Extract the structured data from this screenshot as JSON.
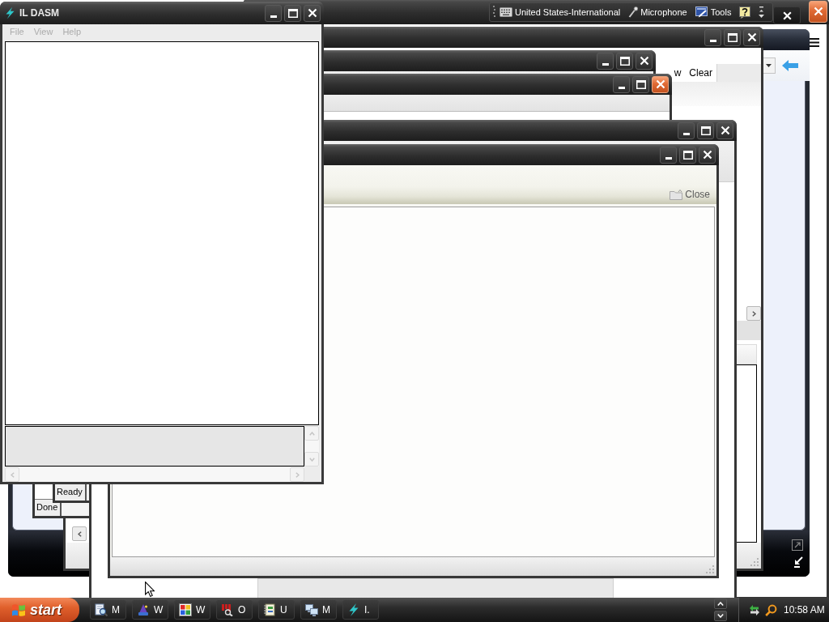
{
  "language_bar": {
    "items": [
      {
        "label": "United States-International"
      },
      {
        "label": "Microphone"
      },
      {
        "label": "Tools"
      }
    ]
  },
  "windows": [
    {
      "kind": "sidebar",
      "active": true,
      "controls": [
        {
          "kind": "close"
        }
      ]
    },
    {
      "kind": "player"
    },
    {
      "kind": "explorer",
      "active": false,
      "controls": [
        {
          "kind": "minimize"
        },
        {
          "kind": "maximize"
        },
        {
          "kind": "close"
        }
      ],
      "toolbar": [
        {
          "label": "w"
        },
        {
          "label": "Clear"
        }
      ]
    },
    {
      "kind": "browser",
      "active": false,
      "controls": [
        {
          "kind": "minimize"
        },
        {
          "kind": "maximize"
        },
        {
          "kind": "close"
        }
      ],
      "status": "Done"
    },
    {
      "kind": "browser",
      "active": true,
      "controls": [
        {
          "kind": "minimize"
        },
        {
          "kind": "maximize"
        },
        {
          "kind": "close"
        }
      ],
      "status": "Ready"
    },
    {
      "kind": "document",
      "active": false,
      "controls": [
        {
          "kind": "minimize"
        },
        {
          "kind": "maximize"
        },
        {
          "kind": "close"
        }
      ]
    },
    {
      "kind": "viewer",
      "active": false,
      "controls": [
        {
          "kind": "minimize"
        },
        {
          "kind": "maximize"
        },
        {
          "kind": "close"
        }
      ],
      "toolbar": [
        {
          "label": "Close"
        }
      ]
    },
    {
      "kind": "ildasm",
      "active": false,
      "controls": [
        {
          "kind": "minimize"
        },
        {
          "kind": "maximize"
        },
        {
          "kind": "close"
        }
      ],
      "title": "IL DASM",
      "menu": [
        {
          "label": "File",
          "disabled": true
        },
        {
          "label": "View",
          "disabled": true
        },
        {
          "label": "Help",
          "disabled": true
        }
      ]
    }
  ],
  "taskbar": {
    "start": "start",
    "buttons": [
      {
        "label": "M"
      },
      {
        "label": "W"
      },
      {
        "label": "W"
      },
      {
        "label": "O"
      },
      {
        "label": "U"
      },
      {
        "label": "M"
      },
      {
        "label": "I."
      }
    ],
    "clock": "10:58 AM"
  }
}
